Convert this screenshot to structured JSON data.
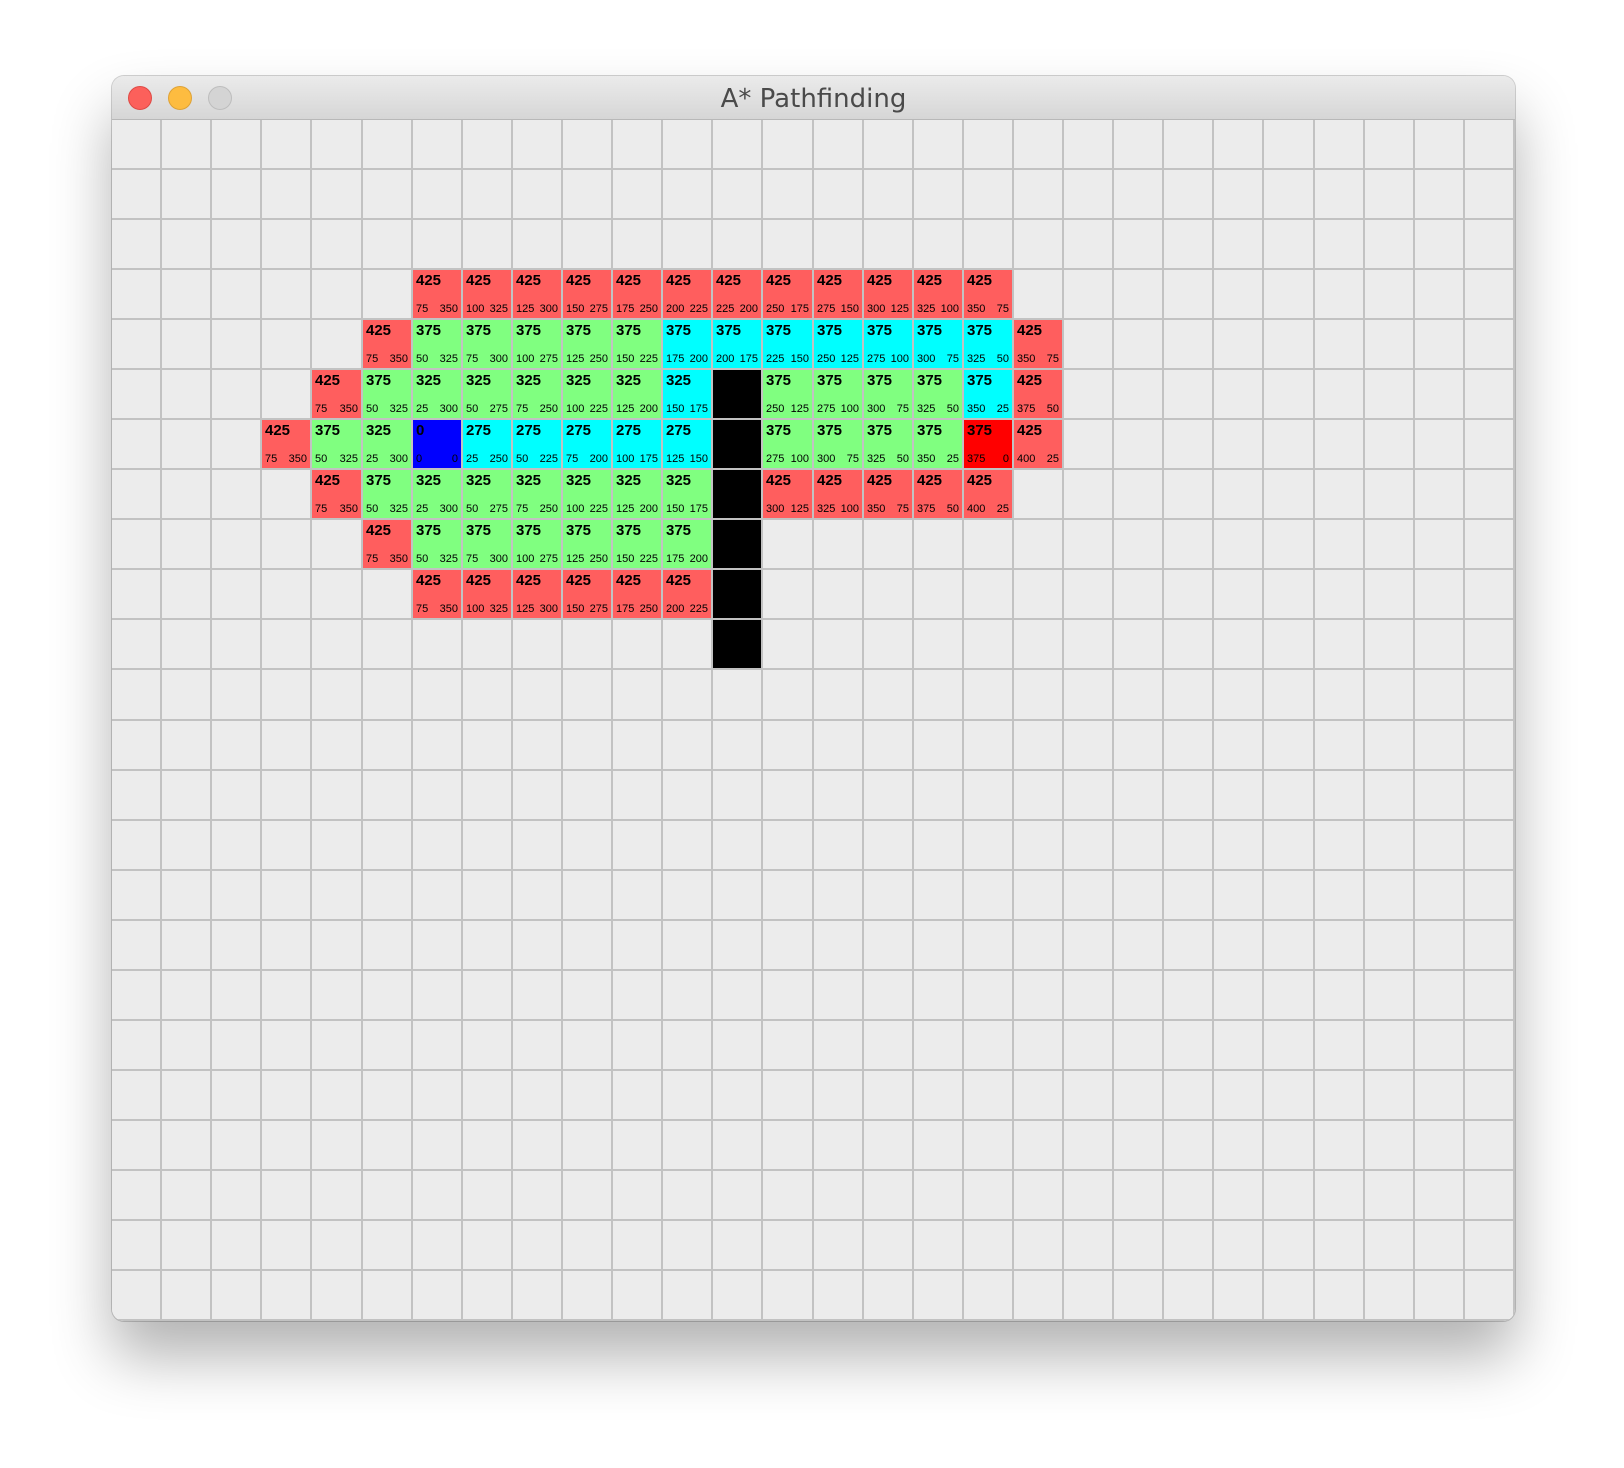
{
  "window": {
    "title": "A* Pathfinding"
  },
  "grid": {
    "cols": 28,
    "rows": 24
  },
  "colors": {
    "background": "#ececec",
    "gridline": "#c2c2c2",
    "open": "#ff5e5e",
    "closed": "#80ff80",
    "path": "#00ffff",
    "start": "#0000ff",
    "end": "#ff0000",
    "wall": "#000000"
  },
  "cells": [
    {
      "r": 3,
      "c": 6,
      "t": "open",
      "f": "425",
      "g": "75",
      "h": "350"
    },
    {
      "r": 3,
      "c": 7,
      "t": "open",
      "f": "425",
      "g": "100",
      "h": "325"
    },
    {
      "r": 3,
      "c": 8,
      "t": "open",
      "f": "425",
      "g": "125",
      "h": "300"
    },
    {
      "r": 3,
      "c": 9,
      "t": "open",
      "f": "425",
      "g": "150",
      "h": "275"
    },
    {
      "r": 3,
      "c": 10,
      "t": "open",
      "f": "425",
      "g": "175",
      "h": "250"
    },
    {
      "r": 3,
      "c": 11,
      "t": "open",
      "f": "425",
      "g": "200",
      "h": "225"
    },
    {
      "r": 3,
      "c": 12,
      "t": "open",
      "f": "425",
      "g": "225",
      "h": "200"
    },
    {
      "r": 3,
      "c": 13,
      "t": "open",
      "f": "425",
      "g": "250",
      "h": "175"
    },
    {
      "r": 3,
      "c": 14,
      "t": "open",
      "f": "425",
      "g": "275",
      "h": "150"
    },
    {
      "r": 3,
      "c": 15,
      "t": "open",
      "f": "425",
      "g": "300",
      "h": "125"
    },
    {
      "r": 3,
      "c": 16,
      "t": "open",
      "f": "425",
      "g": "325",
      "h": "100"
    },
    {
      "r": 3,
      "c": 17,
      "t": "open",
      "f": "425",
      "g": "350",
      "h": "75"
    },
    {
      "r": 4,
      "c": 5,
      "t": "open",
      "f": "425",
      "g": "75",
      "h": "350"
    },
    {
      "r": 4,
      "c": 6,
      "t": "closed",
      "f": "375",
      "g": "50",
      "h": "325"
    },
    {
      "r": 4,
      "c": 7,
      "t": "closed",
      "f": "375",
      "g": "75",
      "h": "300"
    },
    {
      "r": 4,
      "c": 8,
      "t": "closed",
      "f": "375",
      "g": "100",
      "h": "275"
    },
    {
      "r": 4,
      "c": 9,
      "t": "closed",
      "f": "375",
      "g": "125",
      "h": "250"
    },
    {
      "r": 4,
      "c": 10,
      "t": "closed",
      "f": "375",
      "g": "150",
      "h": "225"
    },
    {
      "r": 4,
      "c": 11,
      "t": "path",
      "f": "375",
      "g": "175",
      "h": "200"
    },
    {
      "r": 4,
      "c": 12,
      "t": "path",
      "f": "375",
      "g": "200",
      "h": "175"
    },
    {
      "r": 4,
      "c": 13,
      "t": "path",
      "f": "375",
      "g": "225",
      "h": "150"
    },
    {
      "r": 4,
      "c": 14,
      "t": "path",
      "f": "375",
      "g": "250",
      "h": "125"
    },
    {
      "r": 4,
      "c": 15,
      "t": "path",
      "f": "375",
      "g": "275",
      "h": "100"
    },
    {
      "r": 4,
      "c": 16,
      "t": "path",
      "f": "375",
      "g": "300",
      "h": "75"
    },
    {
      "r": 4,
      "c": 17,
      "t": "path",
      "f": "375",
      "g": "325",
      "h": "50"
    },
    {
      "r": 4,
      "c": 18,
      "t": "open",
      "f": "425",
      "g": "350",
      "h": "75"
    },
    {
      "r": 5,
      "c": 4,
      "t": "open",
      "f": "425",
      "g": "75",
      "h": "350"
    },
    {
      "r": 5,
      "c": 5,
      "t": "closed",
      "f": "375",
      "g": "50",
      "h": "325"
    },
    {
      "r": 5,
      "c": 6,
      "t": "closed",
      "f": "325",
      "g": "25",
      "h": "300"
    },
    {
      "r": 5,
      "c": 7,
      "t": "closed",
      "f": "325",
      "g": "50",
      "h": "275"
    },
    {
      "r": 5,
      "c": 8,
      "t": "closed",
      "f": "325",
      "g": "75",
      "h": "250"
    },
    {
      "r": 5,
      "c": 9,
      "t": "closed",
      "f": "325",
      "g": "100",
      "h": "225"
    },
    {
      "r": 5,
      "c": 10,
      "t": "closed",
      "f": "325",
      "g": "125",
      "h": "200"
    },
    {
      "r": 5,
      "c": 11,
      "t": "path",
      "f": "325",
      "g": "150",
      "h": "175"
    },
    {
      "r": 5,
      "c": 12,
      "t": "wall"
    },
    {
      "r": 5,
      "c": 13,
      "t": "closed",
      "f": "375",
      "g": "250",
      "h": "125"
    },
    {
      "r": 5,
      "c": 14,
      "t": "closed",
      "f": "375",
      "g": "275",
      "h": "100"
    },
    {
      "r": 5,
      "c": 15,
      "t": "closed",
      "f": "375",
      "g": "300",
      "h": "75"
    },
    {
      "r": 5,
      "c": 16,
      "t": "closed",
      "f": "375",
      "g": "325",
      "h": "50"
    },
    {
      "r": 5,
      "c": 17,
      "t": "path",
      "f": "375",
      "g": "350",
      "h": "25"
    },
    {
      "r": 5,
      "c": 18,
      "t": "open",
      "f": "425",
      "g": "375",
      "h": "50"
    },
    {
      "r": 6,
      "c": 3,
      "t": "open",
      "f": "425",
      "g": "75",
      "h": "350"
    },
    {
      "r": 6,
      "c": 4,
      "t": "closed",
      "f": "375",
      "g": "50",
      "h": "325"
    },
    {
      "r": 6,
      "c": 5,
      "t": "closed",
      "f": "325",
      "g": "25",
      "h": "300"
    },
    {
      "r": 6,
      "c": 6,
      "t": "start",
      "f": "0",
      "g": "0",
      "h": "0"
    },
    {
      "r": 6,
      "c": 7,
      "t": "path",
      "f": "275",
      "g": "25",
      "h": "250"
    },
    {
      "r": 6,
      "c": 8,
      "t": "path",
      "f": "275",
      "g": "50",
      "h": "225"
    },
    {
      "r": 6,
      "c": 9,
      "t": "path",
      "f": "275",
      "g": "75",
      "h": "200"
    },
    {
      "r": 6,
      "c": 10,
      "t": "path",
      "f": "275",
      "g": "100",
      "h": "175"
    },
    {
      "r": 6,
      "c": 11,
      "t": "path",
      "f": "275",
      "g": "125",
      "h": "150"
    },
    {
      "r": 6,
      "c": 12,
      "t": "wall"
    },
    {
      "r": 6,
      "c": 13,
      "t": "closed",
      "f": "375",
      "g": "275",
      "h": "100"
    },
    {
      "r": 6,
      "c": 14,
      "t": "closed",
      "f": "375",
      "g": "300",
      "h": "75"
    },
    {
      "r": 6,
      "c": 15,
      "t": "closed",
      "f": "375",
      "g": "325",
      "h": "50"
    },
    {
      "r": 6,
      "c": 16,
      "t": "closed",
      "f": "375",
      "g": "350",
      "h": "25"
    },
    {
      "r": 6,
      "c": 17,
      "t": "end",
      "f": "375",
      "g": "375",
      "h": "0"
    },
    {
      "r": 6,
      "c": 18,
      "t": "open",
      "f": "425",
      "g": "400",
      "h": "25"
    },
    {
      "r": 7,
      "c": 4,
      "t": "open",
      "f": "425",
      "g": "75",
      "h": "350"
    },
    {
      "r": 7,
      "c": 5,
      "t": "closed",
      "f": "375",
      "g": "50",
      "h": "325"
    },
    {
      "r": 7,
      "c": 6,
      "t": "closed",
      "f": "325",
      "g": "25",
      "h": "300"
    },
    {
      "r": 7,
      "c": 7,
      "t": "closed",
      "f": "325",
      "g": "50",
      "h": "275"
    },
    {
      "r": 7,
      "c": 8,
      "t": "closed",
      "f": "325",
      "g": "75",
      "h": "250"
    },
    {
      "r": 7,
      "c": 9,
      "t": "closed",
      "f": "325",
      "g": "100",
      "h": "225"
    },
    {
      "r": 7,
      "c": 10,
      "t": "closed",
      "f": "325",
      "g": "125",
      "h": "200"
    },
    {
      "r": 7,
      "c": 11,
      "t": "closed",
      "f": "325",
      "g": "150",
      "h": "175"
    },
    {
      "r": 7,
      "c": 12,
      "t": "wall"
    },
    {
      "r": 7,
      "c": 13,
      "t": "open",
      "f": "425",
      "g": "300",
      "h": "125"
    },
    {
      "r": 7,
      "c": 14,
      "t": "open",
      "f": "425",
      "g": "325",
      "h": "100"
    },
    {
      "r": 7,
      "c": 15,
      "t": "open",
      "f": "425",
      "g": "350",
      "h": "75"
    },
    {
      "r": 7,
      "c": 16,
      "t": "open",
      "f": "425",
      "g": "375",
      "h": "50"
    },
    {
      "r": 7,
      "c": 17,
      "t": "open",
      "f": "425",
      "g": "400",
      "h": "25"
    },
    {
      "r": 8,
      "c": 5,
      "t": "open",
      "f": "425",
      "g": "75",
      "h": "350"
    },
    {
      "r": 8,
      "c": 6,
      "t": "closed",
      "f": "375",
      "g": "50",
      "h": "325"
    },
    {
      "r": 8,
      "c": 7,
      "t": "closed",
      "f": "375",
      "g": "75",
      "h": "300"
    },
    {
      "r": 8,
      "c": 8,
      "t": "closed",
      "f": "375",
      "g": "100",
      "h": "275"
    },
    {
      "r": 8,
      "c": 9,
      "t": "closed",
      "f": "375",
      "g": "125",
      "h": "250"
    },
    {
      "r": 8,
      "c": 10,
      "t": "closed",
      "f": "375",
      "g": "150",
      "h": "225"
    },
    {
      "r": 8,
      "c": 11,
      "t": "closed",
      "f": "375",
      "g": "175",
      "h": "200"
    },
    {
      "r": 8,
      "c": 12,
      "t": "wall"
    },
    {
      "r": 9,
      "c": 6,
      "t": "open",
      "f": "425",
      "g": "75",
      "h": "350"
    },
    {
      "r": 9,
      "c": 7,
      "t": "open",
      "f": "425",
      "g": "100",
      "h": "325"
    },
    {
      "r": 9,
      "c": 8,
      "t": "open",
      "f": "425",
      "g": "125",
      "h": "300"
    },
    {
      "r": 9,
      "c": 9,
      "t": "open",
      "f": "425",
      "g": "150",
      "h": "275"
    },
    {
      "r": 9,
      "c": 10,
      "t": "open",
      "f": "425",
      "g": "175",
      "h": "250"
    },
    {
      "r": 9,
      "c": 11,
      "t": "open",
      "f": "425",
      "g": "200",
      "h": "225"
    },
    {
      "r": 9,
      "c": 12,
      "t": "wall"
    },
    {
      "r": 10,
      "c": 12,
      "t": "wall"
    }
  ]
}
